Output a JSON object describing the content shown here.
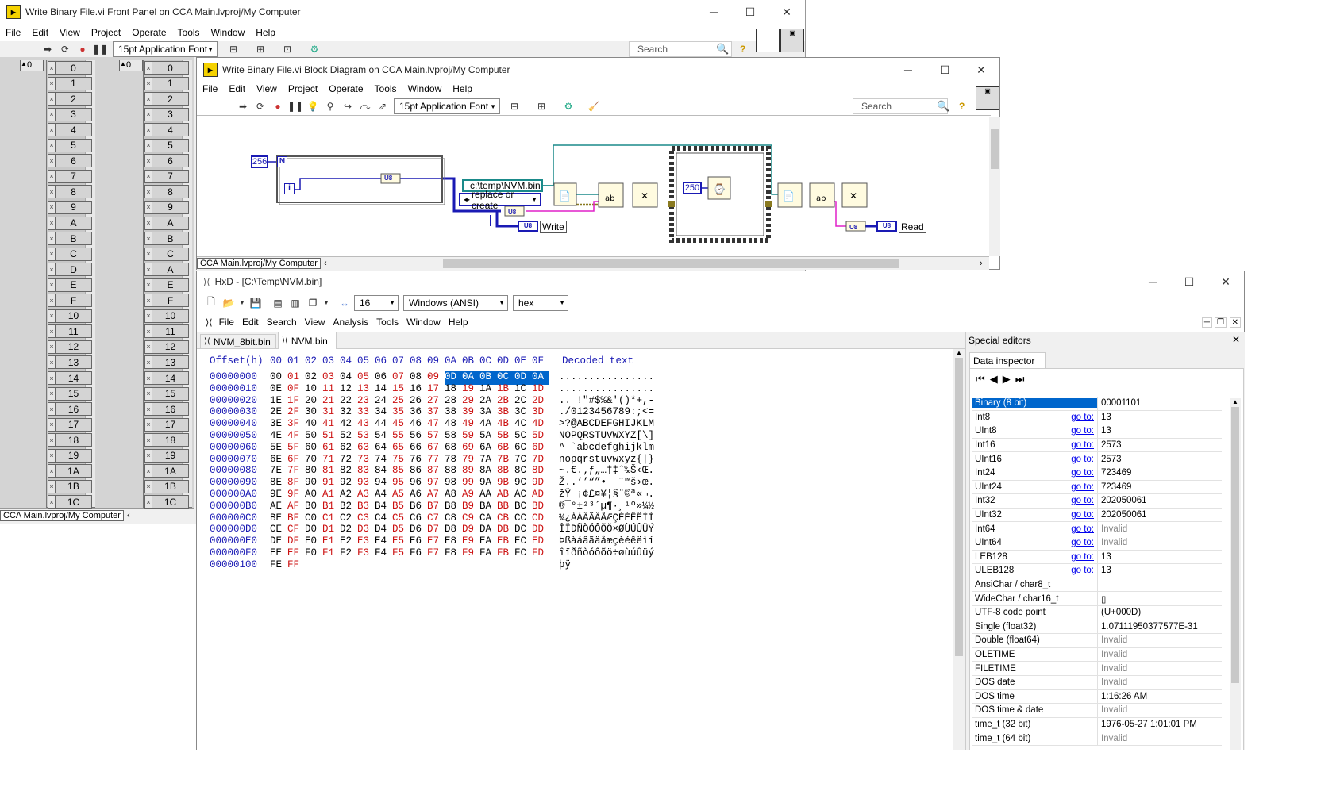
{
  "front_panel": {
    "title": "Write Binary File.vi Front Panel on CCA Main.lvproj/My Computer",
    "menu": [
      "File",
      "Edit",
      "View",
      "Project",
      "Operate",
      "Tools",
      "Window",
      "Help"
    ],
    "font": "15pt Application Font",
    "search_placeholder": "Search",
    "index_left": "0",
    "index_right": "0",
    "array_write_values": [
      "0",
      "1",
      "2",
      "3",
      "4",
      "5",
      "6",
      "7",
      "8",
      "9",
      "A",
      "B",
      "C",
      "D",
      "E",
      "F",
      "10",
      "11",
      "12",
      "13",
      "14",
      "15",
      "16",
      "17",
      "18",
      "19",
      "1A",
      "1B",
      "1C"
    ],
    "array_read_values": [
      "0",
      "1",
      "2",
      "3",
      "4",
      "5",
      "6",
      "7",
      "8",
      "9",
      "A",
      "B",
      "C",
      "A",
      "E",
      "F",
      "10",
      "11",
      "12",
      "13",
      "14",
      "15",
      "16",
      "17",
      "18",
      "19",
      "1A",
      "1B",
      "1C"
    ],
    "status_path": "CCA Main.lvproj/My Computer"
  },
  "block_diagram": {
    "title": "Write Binary File.vi Block Diagram on CCA Main.lvproj/My Computer",
    "menu": [
      "File",
      "Edit",
      "View",
      "Project",
      "Operate",
      "Tools",
      "Window",
      "Help"
    ],
    "font": "15pt Application Font",
    "search_placeholder": "Search",
    "const_count": "256",
    "count_terminal": "N",
    "iter_terminal": "i",
    "u8_label": "U8",
    "path_const": "c:\\temp\\NVM.bin",
    "operation_enum": "replace or create",
    "wait_ms": "250",
    "write_indicator": "Write",
    "read_indicator": "Read",
    "status_path": "CCA Main.lvproj/My Computer"
  },
  "hxd": {
    "title": "HxD - [C:\\Temp\\NVM.bin]",
    "bytes_per_row": "16",
    "charset": "Windows (ANSI)",
    "base": "hex",
    "menu": [
      "File",
      "Edit",
      "Search",
      "View",
      "Analysis",
      "Tools",
      "Window",
      "Help"
    ],
    "tabs": [
      "NVM_8bit.bin",
      "NVM.bin"
    ],
    "header_offset": "Offset(h)",
    "header_cols": [
      "00",
      "01",
      "02",
      "03",
      "04",
      "05",
      "06",
      "07",
      "08",
      "09",
      "0A",
      "0B",
      "0C",
      "0D",
      "0E",
      "0F"
    ],
    "header_decoded": "Decoded text",
    "rows": [
      {
        "off": "00000000",
        "bytes": [
          "00",
          "01",
          "02",
          "03",
          "04",
          "05",
          "06",
          "07",
          "08",
          "09",
          "0D",
          "0A",
          "0B",
          "0C",
          "0D",
          "0A"
        ],
        "text": "................"
      },
      {
        "off": "00000010",
        "bytes": [
          "0E",
          "0F",
          "10",
          "11",
          "12",
          "13",
          "14",
          "15",
          "16",
          "17",
          "18",
          "19",
          "1A",
          "1B",
          "1C",
          "1D"
        ],
        "text": "................"
      },
      {
        "off": "00000020",
        "bytes": [
          "1E",
          "1F",
          "20",
          "21",
          "22",
          "23",
          "24",
          "25",
          "26",
          "27",
          "28",
          "29",
          "2A",
          "2B",
          "2C",
          "2D"
        ],
        "text": ".. !\"#$%&'()*+,-"
      },
      {
        "off": "00000030",
        "bytes": [
          "2E",
          "2F",
          "30",
          "31",
          "32",
          "33",
          "34",
          "35",
          "36",
          "37",
          "38",
          "39",
          "3A",
          "3B",
          "3C",
          "3D"
        ],
        "text": "./0123456789:;<="
      },
      {
        "off": "00000040",
        "bytes": [
          "3E",
          "3F",
          "40",
          "41",
          "42",
          "43",
          "44",
          "45",
          "46",
          "47",
          "48",
          "49",
          "4A",
          "4B",
          "4C",
          "4D"
        ],
        "text": ">?@ABCDEFGHIJKLM"
      },
      {
        "off": "00000050",
        "bytes": [
          "4E",
          "4F",
          "50",
          "51",
          "52",
          "53",
          "54",
          "55",
          "56",
          "57",
          "58",
          "59",
          "5A",
          "5B",
          "5C",
          "5D"
        ],
        "text": "NOPQRSTUVWXYZ[\\]"
      },
      {
        "off": "00000060",
        "bytes": [
          "5E",
          "5F",
          "60",
          "61",
          "62",
          "63",
          "64",
          "65",
          "66",
          "67",
          "68",
          "69",
          "6A",
          "6B",
          "6C",
          "6D"
        ],
        "text": "^_`abcdefghijklm"
      },
      {
        "off": "00000070",
        "bytes": [
          "6E",
          "6F",
          "70",
          "71",
          "72",
          "73",
          "74",
          "75",
          "76",
          "77",
          "78",
          "79",
          "7A",
          "7B",
          "7C",
          "7D"
        ],
        "text": "nopqrstuvwxyz{|}"
      },
      {
        "off": "00000080",
        "bytes": [
          "7E",
          "7F",
          "80",
          "81",
          "82",
          "83",
          "84",
          "85",
          "86",
          "87",
          "88",
          "89",
          "8A",
          "8B",
          "8C",
          "8D"
        ],
        "text": "~.€.‚ƒ„…†‡ˆ‰Š‹Œ."
      },
      {
        "off": "00000090",
        "bytes": [
          "8E",
          "8F",
          "90",
          "91",
          "92",
          "93",
          "94",
          "95",
          "96",
          "97",
          "98",
          "99",
          "9A",
          "9B",
          "9C",
          "9D"
        ],
        "text": "Ž..‘’“”•–—˜™š›œ."
      },
      {
        "off": "000000A0",
        "bytes": [
          "9E",
          "9F",
          "A0",
          "A1",
          "A2",
          "A3",
          "A4",
          "A5",
          "A6",
          "A7",
          "A8",
          "A9",
          "AA",
          "AB",
          "AC",
          "AD"
        ],
        "text": "žŸ ¡¢£¤¥¦§¨©ª«¬."
      },
      {
        "off": "000000B0",
        "bytes": [
          "AE",
          "AF",
          "B0",
          "B1",
          "B2",
          "B3",
          "B4",
          "B5",
          "B6",
          "B7",
          "B8",
          "B9",
          "BA",
          "BB",
          "BC",
          "BD"
        ],
        "text": "®¯°±²³´µ¶·¸¹º»¼½"
      },
      {
        "off": "000000C0",
        "bytes": [
          "BE",
          "BF",
          "C0",
          "C1",
          "C2",
          "C3",
          "C4",
          "C5",
          "C6",
          "C7",
          "C8",
          "C9",
          "CA",
          "CB",
          "CC",
          "CD"
        ],
        "text": "¾¿ÀÁÂÃÄÅÆÇÈÉÊËÌÍ"
      },
      {
        "off": "000000D0",
        "bytes": [
          "CE",
          "CF",
          "D0",
          "D1",
          "D2",
          "D3",
          "D4",
          "D5",
          "D6",
          "D7",
          "D8",
          "D9",
          "DA",
          "DB",
          "DC",
          "DD"
        ],
        "text": "ÎÏÐÑÒÓÔÕÖ×ØÙÚÛÜÝ"
      },
      {
        "off": "000000E0",
        "bytes": [
          "DE",
          "DF",
          "E0",
          "E1",
          "E2",
          "E3",
          "E4",
          "E5",
          "E6",
          "E7",
          "E8",
          "E9",
          "EA",
          "EB",
          "EC",
          "ED"
        ],
        "text": "Þßàáâãäåæçèéêëìí"
      },
      {
        "off": "000000F0",
        "bytes": [
          "EE",
          "EF",
          "F0",
          "F1",
          "F2",
          "F3",
          "F4",
          "F5",
          "F6",
          "F7",
          "F8",
          "F9",
          "FA",
          "FB",
          "FC",
          "FD"
        ],
        "text": "îïðñòóôõö÷øùúûüý"
      },
      {
        "off": "00000100",
        "bytes": [
          "FE",
          "FF"
        ],
        "text": "þÿ"
      }
    ],
    "special_editors_title": "Special editors",
    "data_inspector_tab": "Data inspector",
    "goto_label": "go to:",
    "inspector": [
      {
        "name": "Binary (8 bit)",
        "value": "00001101",
        "goto": false,
        "selected": true
      },
      {
        "name": "Int8",
        "value": "13",
        "goto": true
      },
      {
        "name": "UInt8",
        "value": "13",
        "goto": true
      },
      {
        "name": "Int16",
        "value": "2573",
        "goto": true
      },
      {
        "name": "UInt16",
        "value": "2573",
        "goto": true
      },
      {
        "name": "Int24",
        "value": "723469",
        "goto": true
      },
      {
        "name": "UInt24",
        "value": "723469",
        "goto": true
      },
      {
        "name": "Int32",
        "value": "202050061",
        "goto": true
      },
      {
        "name": "UInt32",
        "value": "202050061",
        "goto": true
      },
      {
        "name": "Int64",
        "value": "Invalid",
        "goto": true,
        "invalid": true
      },
      {
        "name": "UInt64",
        "value": "Invalid",
        "goto": true,
        "invalid": true
      },
      {
        "name": "LEB128",
        "value": "13",
        "goto": true
      },
      {
        "name": "ULEB128",
        "value": "13",
        "goto": true
      },
      {
        "name": "AnsiChar / char8_t",
        "value": "",
        "goto": false
      },
      {
        "name": "WideChar / char16_t",
        "value": "▯",
        "goto": false
      },
      {
        "name": "UTF-8 code point",
        "value": " (U+000D)",
        "goto": false
      },
      {
        "name": "Single (float32)",
        "value": "1.07111950377577E-31",
        "goto": false
      },
      {
        "name": "Double (float64)",
        "value": "Invalid",
        "goto": false,
        "invalid": true
      },
      {
        "name": "OLETIME",
        "value": "Invalid",
        "goto": false,
        "invalid": true
      },
      {
        "name": "FILETIME",
        "value": "Invalid",
        "goto": false,
        "invalid": true
      },
      {
        "name": "DOS date",
        "value": "Invalid",
        "goto": false,
        "invalid": true
      },
      {
        "name": "DOS time",
        "value": "1:16:26 AM",
        "goto": false
      },
      {
        "name": "DOS time & date",
        "value": "Invalid",
        "goto": false,
        "invalid": true
      },
      {
        "name": "time_t (32 bit)",
        "value": "1976-05-27 1:01:01 PM",
        "goto": false
      },
      {
        "name": "time_t (64 bit)",
        "value": "Invalid",
        "goto": false,
        "invalid": true
      }
    ]
  }
}
